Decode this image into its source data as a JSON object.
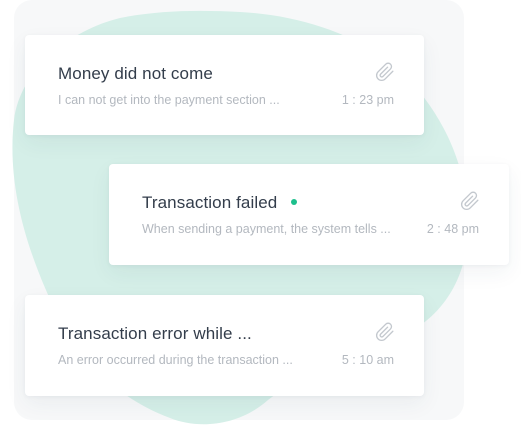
{
  "colors": {
    "blob": "#d5efe8",
    "online_dot": "#1dbf8c",
    "title_text": "#333d4b",
    "muted_text": "#b3b8bf"
  },
  "tickets": [
    {
      "title": "Money did not come",
      "preview": "I can not get into the payment section ...",
      "time": "1 : 23 pm",
      "icon": "paperclip-icon",
      "status_dot": false
    },
    {
      "title": "Transaction failed",
      "preview": "When sending a payment, the system tells ...",
      "time": "2 : 48 pm",
      "icon": "paperclip-icon",
      "status_dot": true
    },
    {
      "title": "Transaction error while ...",
      "preview": "An error occurred during the transaction ...",
      "time": "5 : 10 am",
      "icon": "paperclip-icon",
      "status_dot": false
    }
  ]
}
